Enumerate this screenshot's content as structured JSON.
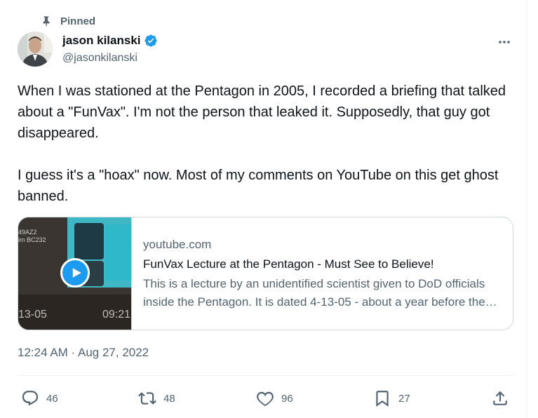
{
  "pinned": {
    "label": "Pinned"
  },
  "author": {
    "name": "jason kilanski",
    "handle": "@jasonkilanski"
  },
  "tweet": {
    "text": "When I was stationed at the Pentagon in 2005, I recorded a briefing that talked about a \"FunVax\". I'm not the person that leaked it. Supposedly, that guy got disappeared.\n\nI guess it's a \"hoax\" now. Most of my comments on YouTube on this get ghost banned.",
    "timestamp": "12:24 AM · Aug 27, 2022"
  },
  "card": {
    "domain": "youtube.com",
    "title": "FunVax Lecture at the Pentagon - Must See to Believe!",
    "description": "This is a lecture by an unidentified scientist given to DoD officials inside the Pentagon. It is dated 4-13-05 - about a year before the first FunVax patent was filed.",
    "thumb_label_a": "49AZ2",
    "thumb_label_b": "im BC232",
    "thumb_date": "13-05",
    "thumb_time": "09:21"
  },
  "actions": {
    "replies": "46",
    "reposts": "48",
    "likes": "96",
    "bookmarks": "27"
  },
  "colors": {
    "accent": "#1d9bf0",
    "muted": "#536471",
    "text": "#0f1419",
    "border": "#cfd9de"
  }
}
